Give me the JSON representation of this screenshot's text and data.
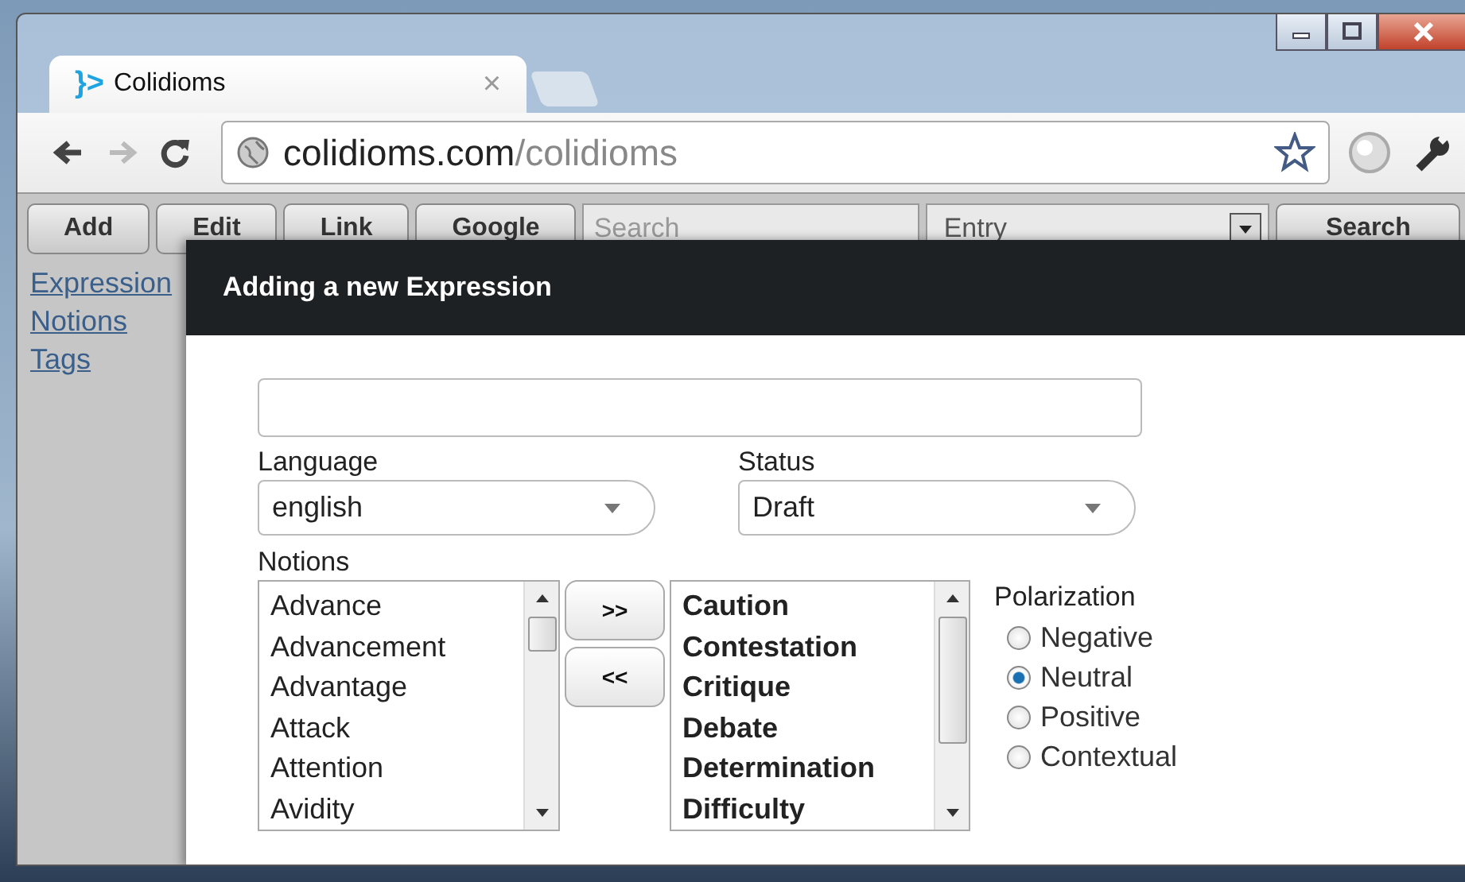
{
  "browser": {
    "tab": {
      "logo": "}>",
      "title": "Colidioms",
      "close": "×"
    },
    "address": {
      "host": "colidioms.com",
      "path": "/colidioms"
    }
  },
  "toolbar": {
    "buttons": [
      "Add",
      "Edit",
      "Link",
      "Google"
    ],
    "search": {
      "placeholder": "Search"
    },
    "entry": {
      "value": "Entry"
    },
    "search_button": "Search"
  },
  "sidebar": {
    "links": [
      "Expression",
      "Notions",
      "Tags"
    ]
  },
  "dialog": {
    "title": "Adding a new Expression",
    "language": {
      "label": "Language",
      "value": "english"
    },
    "status": {
      "label": "Status",
      "value": "Draft"
    },
    "notions": {
      "label": "Notions",
      "available": [
        "Advance",
        "Advancement",
        "Advantage",
        "Attack",
        "Attention",
        "Avidity"
      ],
      "chosen": [
        "Caution",
        "Contestation",
        "Critique",
        "Debate",
        "Determination",
        "Difficulty"
      ]
    },
    "move_buttons": [
      ">>",
      "<<"
    ],
    "polarization": {
      "label": "Polarization",
      "options": [
        {
          "label": "Negative",
          "selected": false
        },
        {
          "label": "Neutral",
          "selected": true
        },
        {
          "label": "Positive",
          "selected": false
        },
        {
          "label": "Contextual",
          "selected": false
        }
      ]
    }
  }
}
